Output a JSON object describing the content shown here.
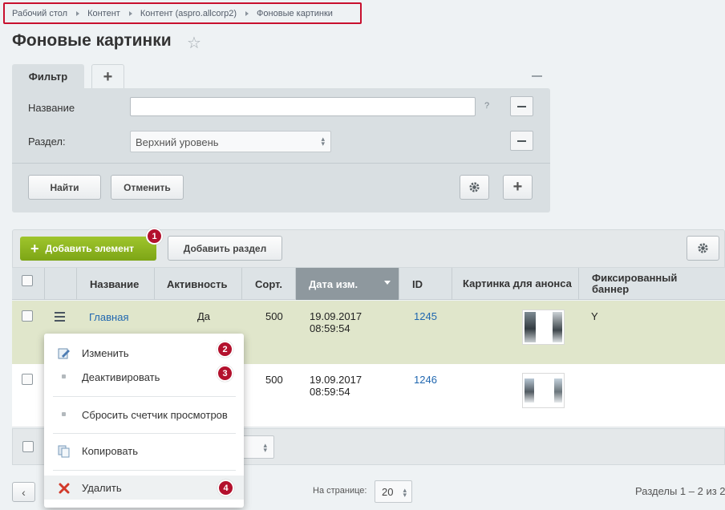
{
  "breadcrumbs": [
    "Рабочий стол",
    "Контент",
    "Контент (aspro.allcorp2)",
    "Фоновые картинки"
  ],
  "page": {
    "title": "Фоновые картинки",
    "star": "☆"
  },
  "filter": {
    "tab_label": "Фильтр",
    "add_tab": "+",
    "fields": [
      {
        "label": "Название",
        "value": "",
        "help": "?"
      },
      {
        "label": "Раздел:",
        "value": "Верхний уровень"
      }
    ],
    "find_button": "Найти",
    "cancel_button": "Отменить",
    "add_field_button": "+"
  },
  "toolbar": {
    "add_element": "Добавить элемент",
    "add_section": "Добавить раздел"
  },
  "table": {
    "columns": [
      "Название",
      "Активность",
      "Сорт.",
      "Дата изм.",
      "ID",
      "Картинка для анонса",
      "Фиксированный баннер"
    ],
    "rows": [
      {
        "name": "Главная",
        "active": "Да",
        "sort": "500",
        "date": "19.09.2017",
        "time": "08:59:54",
        "id": "1245",
        "banner": "Y"
      },
      {
        "name": "",
        "active": "",
        "sort": "500",
        "date": "19.09.2017",
        "time": "08:59:54",
        "id": "1246",
        "banner": ""
      }
    ]
  },
  "context_menu": {
    "items": [
      {
        "label": "Изменить",
        "badge": "2"
      },
      {
        "label": "Деактивировать",
        "badge": "3"
      },
      {
        "label": "Сбросить счетчик просмотров"
      },
      {
        "label": "Копировать"
      },
      {
        "label": "Удалить",
        "badge": "4"
      }
    ]
  },
  "badges": {
    "add_element": "1"
  },
  "pagination": {
    "prev": "‹",
    "per_page_label": "На странице:",
    "per_page_value": "20",
    "summary": "Разделы 1 – 2 из 2"
  },
  "colors": {
    "accent_green": "#8cb520",
    "badge_red": "#b3112d",
    "link": "#2067b0",
    "breadcrumb_highlight": "#c8102e"
  }
}
